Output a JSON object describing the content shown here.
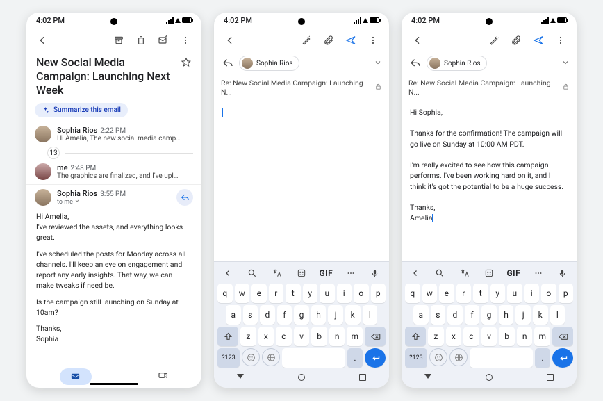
{
  "status": {
    "time": "4:02 PM"
  },
  "thread": {
    "title": "New Social Media Campaign: Launching Next Week",
    "summarize_label": "Summarize this email",
    "collapsed_count": "13",
    "messages": [
      {
        "sender": "Sophia Rios",
        "time": "2:22 PM",
        "snippet": "Hi Amelia, The new social media campaign for ou..."
      },
      {
        "sender": "me",
        "time": "2:48 PM",
        "snippet": "The graphics are finalized, and I've uploaded the..."
      },
      {
        "sender": "Sophia Rios",
        "time": "3:55 PM",
        "to": "to me"
      }
    ],
    "body": {
      "greeting": "Hi Amelia,",
      "p1": "I've reviewed the assets, and everything looks great.",
      "p2": "I've scheduled the posts for Monday across all channels. I'll keep an eye on engagement and report any early insights. That way, we can make tweaks if need be.",
      "p3": "Is the campaign still launching on Sunday at 10am?",
      "sign1": "Thanks,",
      "sign2": "Sophia"
    }
  },
  "compose": {
    "recipient": "Sophia Rios",
    "subject": "Re: New Social Media Campaign: Launching N...",
    "draft_empty": "",
    "draft_full": {
      "greeting": "Hi Sophia,",
      "p1": "Thanks for the confirmation! The campaign will go live on Sunday at 10:00 AM PDT.",
      "p2": "I'm really excited to see how this campaign performs. I've been working hard on it, and I think it's got the potential to be a huge success.",
      "sign1": "Thanks,",
      "sign2": "Amelia"
    }
  },
  "keyboard": {
    "row1": [
      "q",
      "w",
      "e",
      "r",
      "t",
      "y",
      "u",
      "i",
      "o",
      "p"
    ],
    "row2": [
      "a",
      "s",
      "d",
      "f",
      "g",
      "h",
      "j",
      "k",
      "l"
    ],
    "row3": [
      "z",
      "x",
      "c",
      "v",
      "b",
      "n",
      "m"
    ],
    "num_label": "?123",
    "gif_label": "GIF"
  }
}
